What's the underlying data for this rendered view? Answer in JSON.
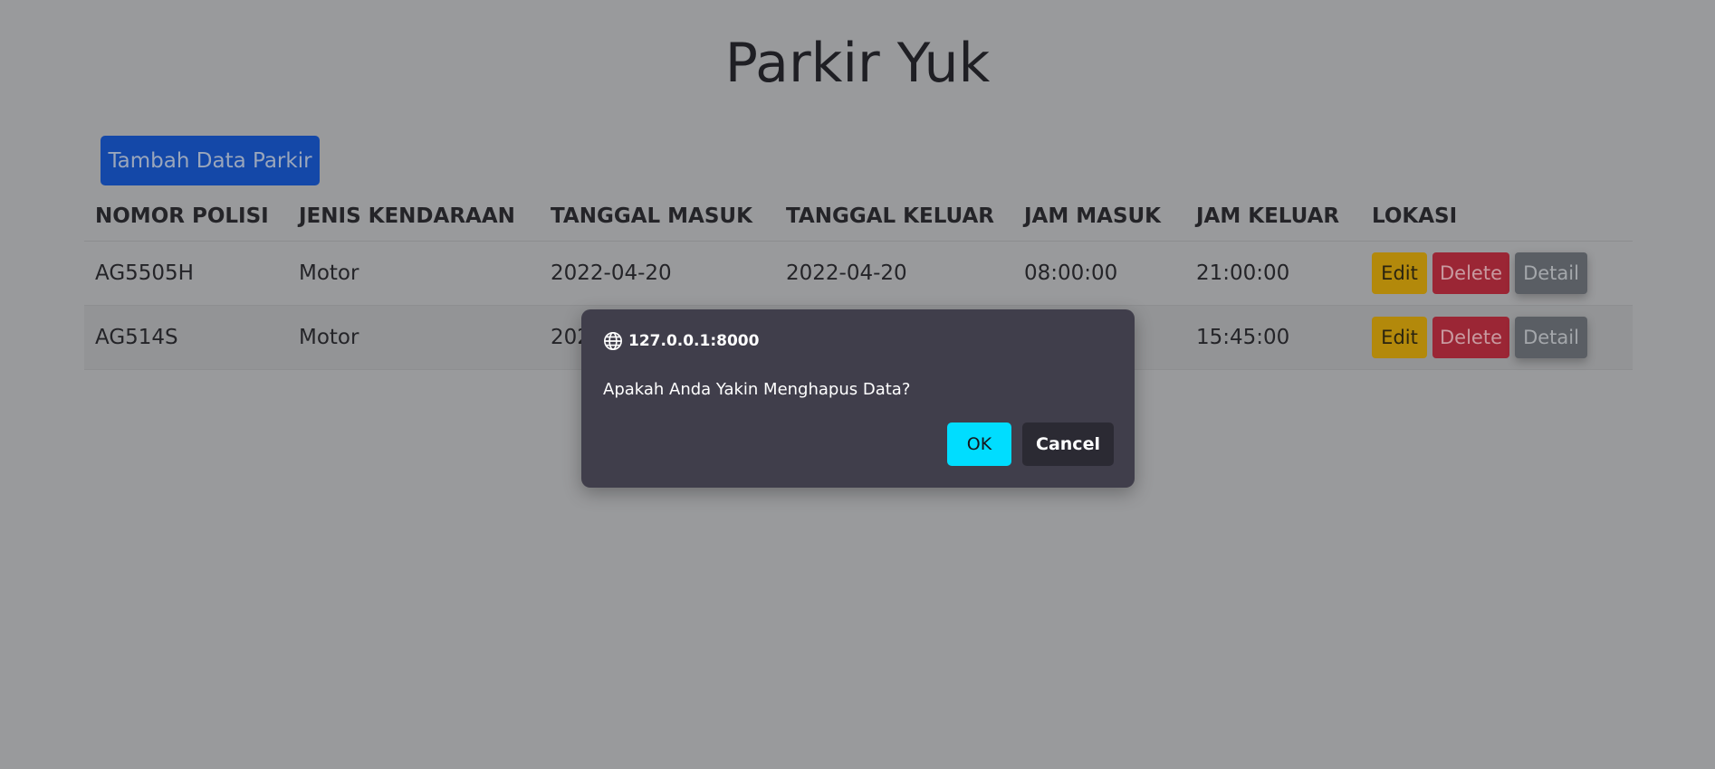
{
  "page": {
    "title": "Parkir Yuk"
  },
  "toolbar": {
    "add_label": "Tambah Data Parkir"
  },
  "table": {
    "headers": [
      "NOMOR POLISI",
      "JENIS KENDARAAN",
      "TANGGAL MASUK",
      "TANGGAL KELUAR",
      "JAM MASUK",
      "JAM KELUAR",
      "LOKASI"
    ],
    "rows": [
      {
        "nomor_polisi": "AG5505H",
        "jenis": "Motor",
        "tgl_masuk": "2022-04-20",
        "tgl_keluar": "2022-04-20",
        "jam_masuk": "08:00:00",
        "jam_keluar": "21:00:00"
      },
      {
        "nomor_polisi": "AG514S",
        "jenis": "Motor",
        "tgl_masuk": "202",
        "tgl_keluar": "",
        "jam_masuk": "",
        "jam_keluar": "15:45:00"
      }
    ],
    "actions": {
      "edit": "Edit",
      "delete": "Delete",
      "detail": "Detail"
    }
  },
  "dialog": {
    "origin": "127.0.0.1:8000",
    "message": "Apakah Anda Yakin Menghapus Data?",
    "ok_label": "OK",
    "cancel_label": "Cancel"
  },
  "colors": {
    "primary": "#1448a8",
    "warning": "#b3890b",
    "danger": "#9b2635",
    "secondary": "#5a5e64",
    "dialog_bg": "#403e4b",
    "ok_accent": "#00ddff"
  }
}
